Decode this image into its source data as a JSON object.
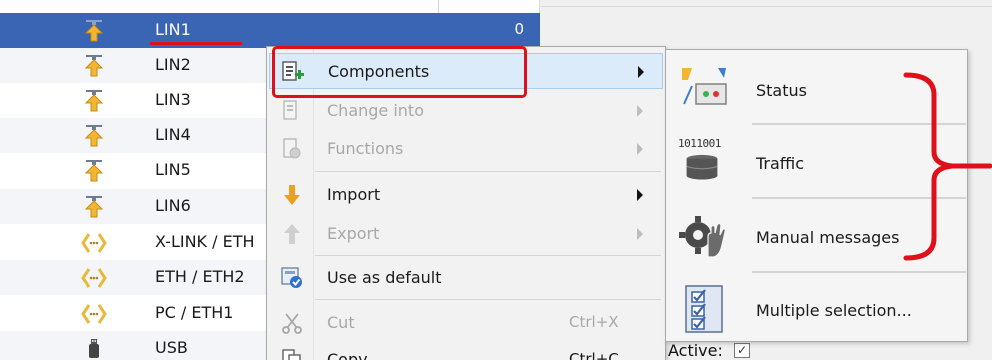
{
  "tree": {
    "rows": [
      {
        "label": "LIN1",
        "value": "0",
        "icon": "lin-bus-icon"
      },
      {
        "label": "LIN2",
        "icon": "lin-bus-icon"
      },
      {
        "label": "LIN3",
        "icon": "lin-bus-icon"
      },
      {
        "label": "LIN4",
        "icon": "lin-bus-icon"
      },
      {
        "label": "LIN5",
        "icon": "lin-bus-icon"
      },
      {
        "label": "LIN6",
        "icon": "lin-bus-icon"
      },
      {
        "label": "X-LINK / ETH",
        "icon": "ethernet-link-icon"
      },
      {
        "label": "ETH / ETH2",
        "icon": "ethernet-link-icon"
      },
      {
        "label": "PC / ETH1",
        "icon": "ethernet-link-icon"
      },
      {
        "label": "USB",
        "icon": "usb-icon"
      }
    ]
  },
  "context_menu": {
    "items": [
      {
        "label": "Components",
        "icon": "components-icon",
        "submenu": true,
        "enabled": true
      },
      {
        "label": "Change into",
        "icon": "change-into-icon",
        "submenu": true,
        "enabled": false
      },
      {
        "label": "Functions",
        "icon": "functions-icon",
        "submenu": true,
        "enabled": false
      },
      {
        "label": "Import",
        "icon": "import-arrow-icon",
        "submenu": true,
        "enabled": true
      },
      {
        "label": "Export",
        "icon": "export-arrow-icon",
        "submenu": true,
        "enabled": false
      },
      {
        "label": "Use as default",
        "icon": "use-default-icon",
        "submenu": false,
        "enabled": true
      },
      {
        "label": "Cut",
        "shortcut": "Ctrl+X",
        "icon": "scissors-icon",
        "enabled": false
      },
      {
        "label": "Copy",
        "shortcut": "Ctrl+C",
        "icon": "copy-icon",
        "enabled": true
      }
    ]
  },
  "submenu": {
    "items": [
      {
        "label": "Status",
        "icon": "status-panel-icon"
      },
      {
        "label": "Traffic",
        "icon": "traffic-database-icon",
        "icon_text": "1011001"
      },
      {
        "label": "Manual messages",
        "icon": "gear-hand-icon"
      },
      {
        "label": "Multiple selection...",
        "icon": "checklist-icon"
      }
    ]
  },
  "footer": {
    "active_label": "Active:",
    "active_checked": true
  },
  "colors": {
    "selection": "#3a64b4",
    "annotation_red": "#e0101a",
    "menu_bg": "#f2f2f2",
    "hover_bg": "#dcebfa",
    "disabled_text": "#a8a8a8"
  }
}
